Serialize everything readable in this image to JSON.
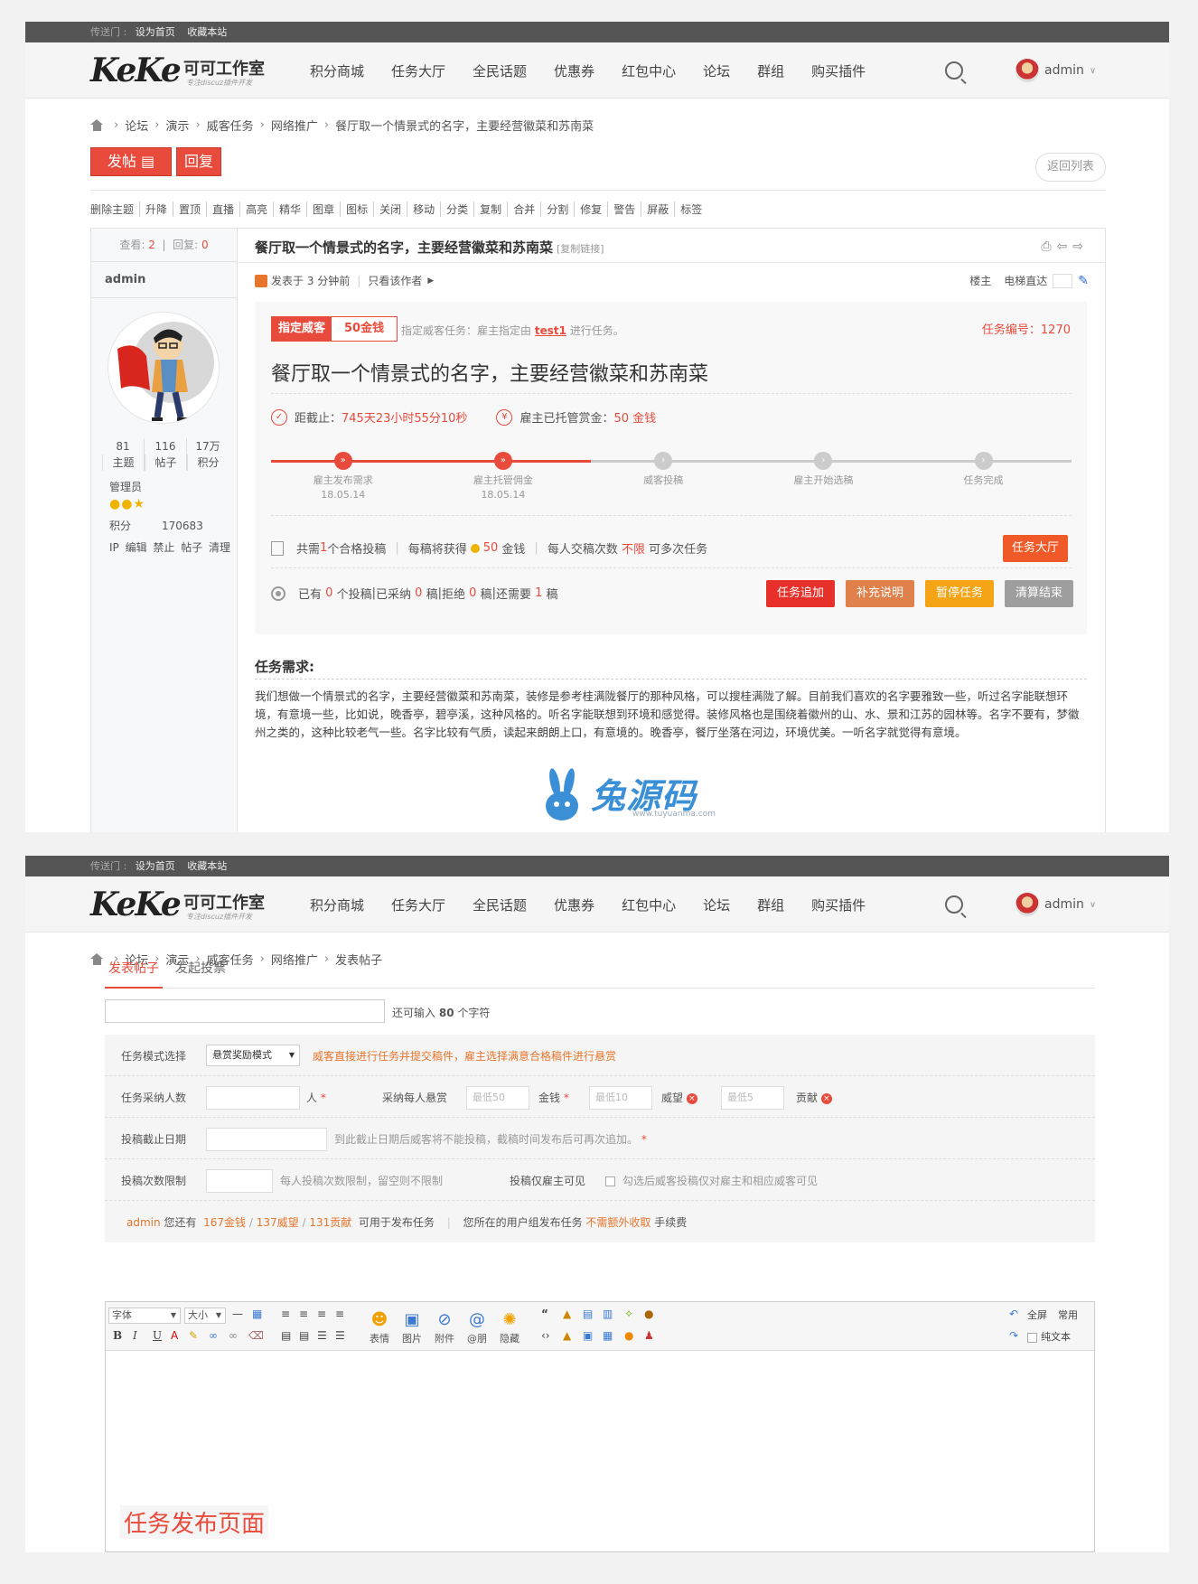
{
  "topbar": {
    "label": "传送门 :",
    "set_home": "设为首页",
    "bookmark": "收藏本站"
  },
  "brand": {
    "logo": "KeKe",
    "name": "可可工作室",
    "slogan": "专注discuz插件开发"
  },
  "nav": [
    "积分商城",
    "任务大厅",
    "全民话题",
    "优惠券",
    "红包中心",
    "论坛",
    "群组",
    "购买插件"
  ],
  "user": {
    "name": "admin"
  },
  "thread": {
    "breadcrumb": [
      "论坛",
      "演示",
      "威客任务",
      "网络推广",
      "餐厅取一个情景式的名字，主要经营徽菜和苏南菜"
    ],
    "post_button": "发帖",
    "reply_button": "回复",
    "back_button": "返回列表",
    "mod_tools": [
      "删除主题",
      "升降",
      "置顶",
      "直播",
      "高亮",
      "精华",
      "图章",
      "图标",
      "关闭",
      "移动",
      "分类",
      "复制",
      "合并",
      "分割",
      "修复",
      "警告",
      "屏蔽",
      "标签"
    ],
    "views_label": "查看:",
    "views": "2",
    "replies_label": "回复:",
    "replies": "0",
    "title": "餐厅取一个情景式的名字，主要经营徽菜和苏南菜",
    "copy_link": "[复制链接]",
    "author": "admin",
    "posted": "发表于 3 分钟前",
    "only_author": "只看该作者",
    "floor": "楼主",
    "elevator": "电梯直达",
    "stats": [
      {
        "value": "81",
        "label": "主题"
      },
      {
        "value": "116",
        "label": "帖子"
      },
      {
        "value": "17万",
        "label": "积分"
      }
    ],
    "role": "管理员",
    "score_label": "积分",
    "score": "170683",
    "user_ops": "IP 编辑 禁止 帖子 清理"
  },
  "task": {
    "badge_type": "指定威客",
    "badge_reward": "50金钱",
    "desc_prefix": "指定威客任务：雇主指定由",
    "desc_user": "test1",
    "desc_suffix": "进行任务。",
    "number_label": "任务编号：",
    "number": "1270",
    "title": "餐厅取一个情景式的名字，主要经营徽菜和苏南菜",
    "deadline_label": "距截止：",
    "deadline": "745天23小时55分10秒",
    "escrow_label": "雇主已托管赏金：",
    "escrow": "50 金钱",
    "progress_fraction": 0.4,
    "steps": [
      {
        "label": "雇主发布需求",
        "date": "18.05.14",
        "done": true
      },
      {
        "label": "雇主托管佣金",
        "date": "18.05.14",
        "done": true
      },
      {
        "label": "威客投稿",
        "date": "",
        "done": false
      },
      {
        "label": "雇主开始选稿",
        "date": "",
        "done": false
      },
      {
        "label": "任务完成",
        "date": "",
        "done": false
      }
    ],
    "need_a": "共需",
    "need_n": "1",
    "need_b": "个合格投稿",
    "each_a": "每稿将获得",
    "each_n": "50",
    "each_b": "金钱",
    "times_a": "每人交稿次数",
    "times_n": "不限",
    "times_b": "可多次任务",
    "hall_button": "任务大厅",
    "have_a": "已有",
    "have_n": "0",
    "have_b": "个投稿",
    "acc_a": "已采纳",
    "acc_n": "0",
    "acc_b": "稿",
    "rej_a": "拒绝",
    "rej_n": "0",
    "rej_b": "稿",
    "still_a": "还需要",
    "still_n": "1",
    "still_b": "稿",
    "buttons": [
      "任务追加",
      "补充说明",
      "暂停任务",
      "清算结束"
    ],
    "button_colors": [
      "#e8302a",
      "#e0804a",
      "#f5a416",
      "#9e9e9e"
    ],
    "req_heading": "任务需求:",
    "req_text": "我们想做一个情景式的名字，主要经营徽菜和苏南菜，装修是参考桂满陇餐厅的那种风格，可以搜桂满陇了解。目前我们喜欢的名字要雅致一些，听过名字能联想环境，有意境一些，比如说，晚香亭，碧亭溪，这种风格的。听名字能联想到环境和感觉得。装修风格也是围绕着徽州的山、水、景和江苏的园林等。名字不要有，梦徽州之类的，这种比较老气一些。名字比较有气质，读起来朗朗上口，有意境的。晚香亭，餐厅坐落在河边，环境优美。一听名字就觉得有意境。"
  },
  "watermark": {
    "text": "兔源码",
    "url": "www.tuyuanma.com"
  },
  "compose": {
    "breadcrumb": [
      "论坛",
      "演示",
      "威客任务",
      "网络推广",
      "发表帖子"
    ],
    "tabs": [
      "发表帖子",
      "发起投票"
    ],
    "subject_hint_a": "还可输入",
    "subject_hint_n": "80",
    "subject_hint_b": "个字符",
    "mode_label": "任务模式选择",
    "mode_value": "悬赏奖励模式",
    "mode_note": "威客直接进行任务并提交稿件，雇主选择满意合格稿件进行悬赏",
    "count_label": "任务采纳人数",
    "count_unit": "人",
    "reward_label": "采纳每人悬赏",
    "reward_ph1": "最低50",
    "reward_u1": "金钱",
    "reward_ph2": "最低10",
    "reward_u2": "威望",
    "reward_ph3": "最低5",
    "reward_u3": "贡献",
    "deadline_label": "投稿截止日期",
    "deadline_note": "到此截止日期后威客将不能投稿，截稿时间发布后可再次追加。",
    "limit_label": "投稿次数限制",
    "limit_note": "每人投稿次数限制，留空则不限制",
    "visible_label": "投稿仅雇主可见",
    "visible_note": "勾选后威客投稿仅对雇主和相应威客可见",
    "bal_user": "admin",
    "bal_a": "您还有",
    "bal_1": "167金钱",
    "bal_2": "137威望",
    "bal_3": "131贡献",
    "bal_b": "可用于发布任务",
    "group_a": "您所在的用户组发布任务",
    "group_b": "不需额外收取",
    "group_c": "手续费",
    "font_label": "字体",
    "size_label": "大小",
    "tools": [
      "表情",
      "图片",
      "附件",
      "@朋",
      "隐藏"
    ],
    "fullscreen": "全屏",
    "common": "常用",
    "plaintext": "纯文本",
    "caption": "任务发布页面"
  }
}
